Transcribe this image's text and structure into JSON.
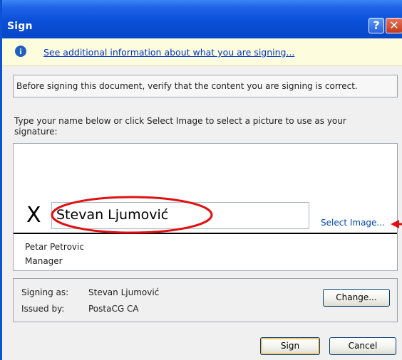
{
  "window": {
    "title": "Sign",
    "help_glyph": "?",
    "close_glyph": "✕"
  },
  "info_bar": {
    "icon": "info-icon",
    "icon_glyph": "i",
    "link_text": "See additional information about what you are signing..."
  },
  "notice": {
    "text": "Before signing this document, verify that the content you are signing is correct."
  },
  "instruction": {
    "text": "Type your name below or click Select Image to select a picture to use as your signature:"
  },
  "signature": {
    "x_mark": "X",
    "typed_name": "Stevan Ljumović",
    "select_image_label": "Select Image...",
    "signer_name": "Petar Petrovic",
    "signer_title": "Manager"
  },
  "signing_as": {
    "signing_as_label": "Signing as:",
    "signing_as_value": "Stevan Ljumović",
    "issued_by_label": "Issued by:",
    "issued_by_value": "PostaCG CA",
    "change_button": "Change..."
  },
  "footer": {
    "sign_button": "Sign",
    "cancel_button": "Cancel"
  },
  "colors": {
    "title_bar": "#0a4fd8",
    "link": "#0033cc",
    "annotation": "#e01010"
  }
}
